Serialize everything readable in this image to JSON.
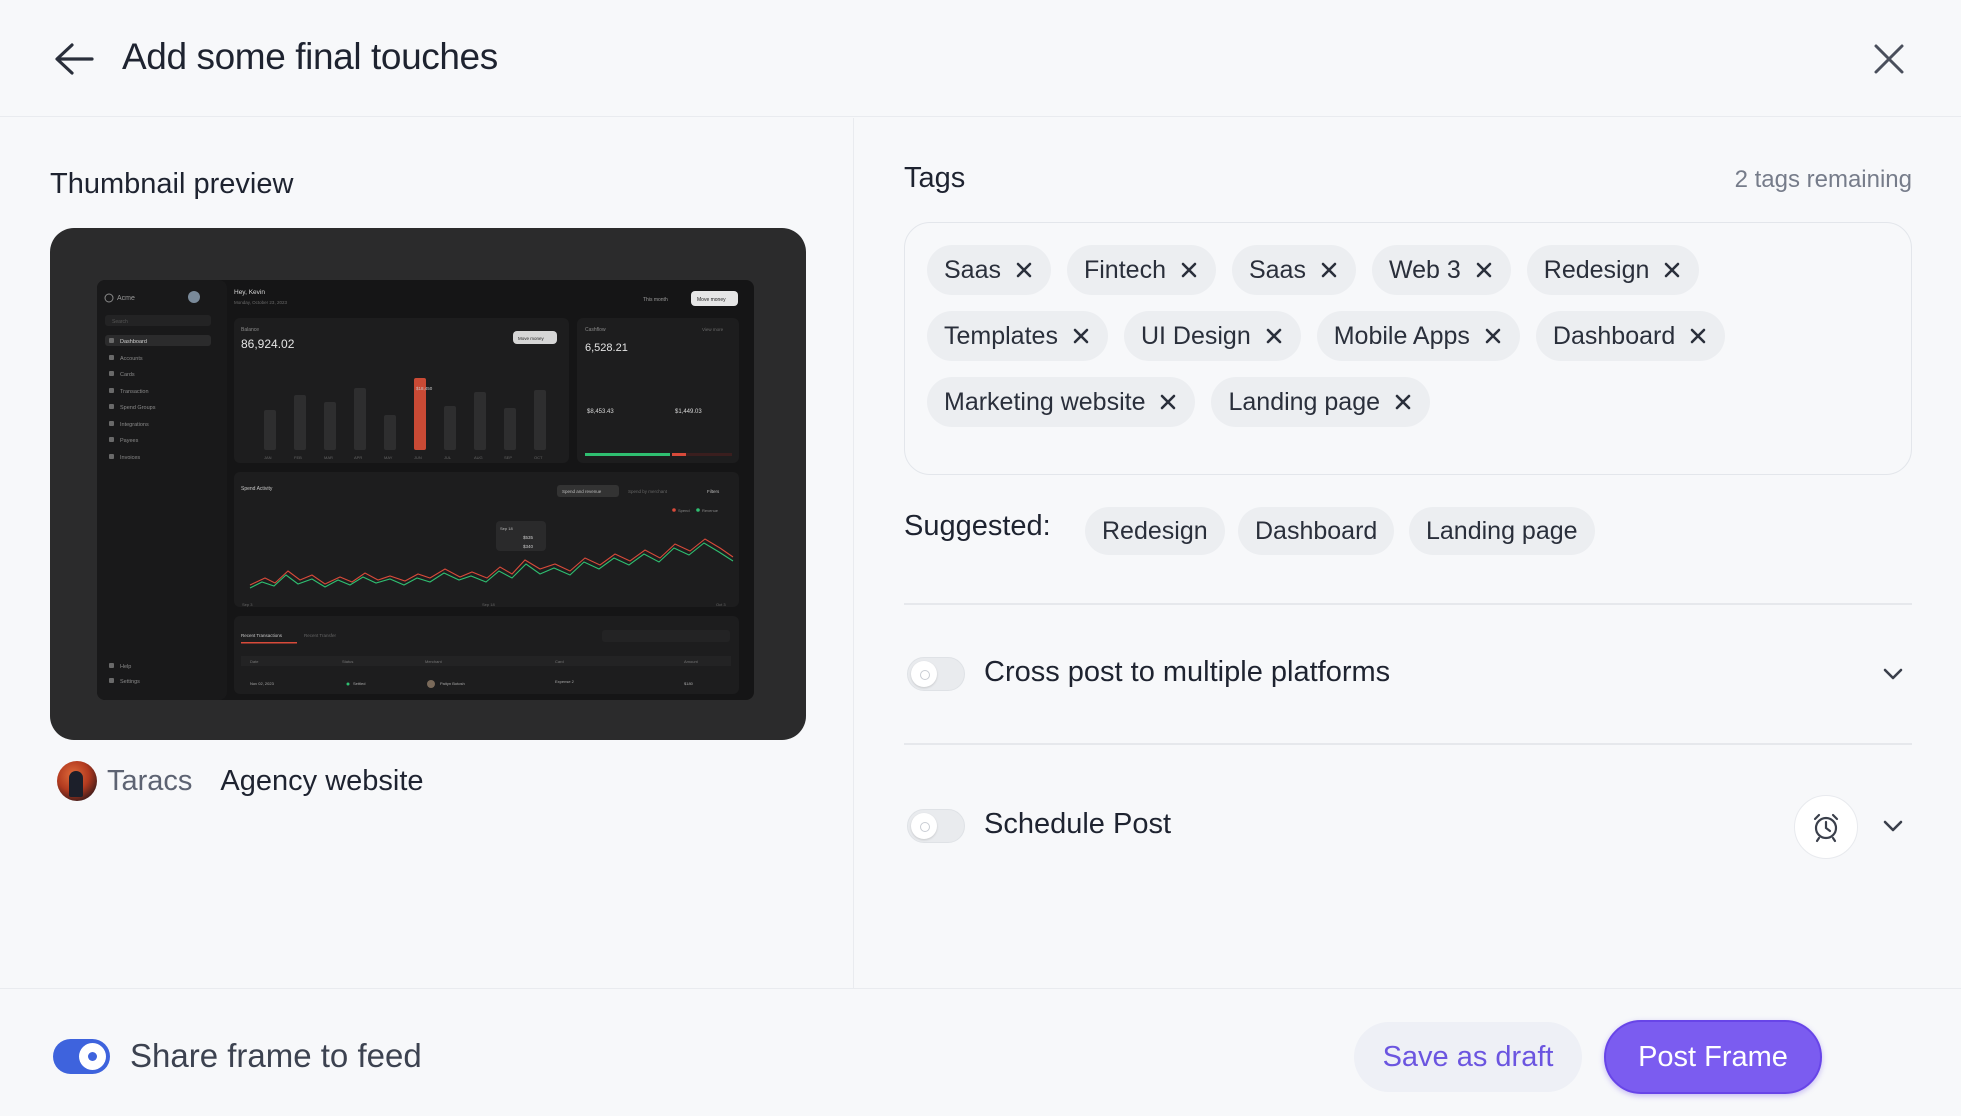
{
  "header": {
    "title": "Add some final touches"
  },
  "thumbnail": {
    "label": "Thumbnail preview",
    "author": "Taracs",
    "project": "Agency website",
    "preview": {
      "brand": "Acme",
      "greeting": "Hey, Kevin",
      "date": "Monday, October 23, 2023",
      "period": "This month",
      "move_money": "Move money",
      "search": "Search",
      "nav": [
        "Dashboard",
        "Accounts",
        "Cards",
        "Transaction",
        "Spend Groups",
        "Integrations",
        "Payees",
        "Invoices"
      ],
      "nav_bottom": [
        "Help",
        "Settings"
      ],
      "balance_label": "Balance",
      "balance_value": "86,924.02",
      "balance_bars": [
        40,
        55,
        48,
        62,
        35,
        72,
        44,
        58,
        42,
        60
      ],
      "balance_highlight": "$18,450",
      "months": [
        "JAN",
        "FEB",
        "MAR",
        "APR",
        "MAY",
        "JUN",
        "JUL",
        "AUG",
        "SEP",
        "OCT"
      ],
      "cashflow_label": "Cashflow",
      "cashflow_value": "6,528.21",
      "view_more": "View more",
      "cash_in": "$8,453.43",
      "cash_out": "$1,449.03",
      "spend_title": "Spend Activity",
      "spend_tab_1": "Spend and revenue",
      "spend_tab_2": "Spend by merchant",
      "filters": "Filters",
      "legend_spend": "Spend",
      "legend_revenue": "Revenue",
      "tooltip_date": "Sep 18",
      "tooltip_spend": "$535",
      "tooltip_revenue": "$340",
      "axis_start": "Sep 3",
      "axis_mid": "Sep 18",
      "axis_end": "Oct 3",
      "tx_tab_1": "Recent Transactions",
      "tx_tab_2": "Recent Transfer",
      "tx_headers": [
        "Date",
        "Status",
        "Merchant",
        "Card",
        "Amount"
      ],
      "tx_row": [
        "Nov 02, 2023",
        "Settled",
        "Paityn Botosh",
        "Expense 2",
        "$180"
      ]
    }
  },
  "tags": {
    "title": "Tags",
    "remaining": "2 tags remaining",
    "rows": [
      [
        "Saas",
        "Fintech",
        "Saas",
        "Web 3",
        "Redesign"
      ],
      [
        "Templates",
        "UI Design",
        "Mobile Apps",
        "Dashboard"
      ],
      [
        "Marketing website",
        "Landing page"
      ]
    ]
  },
  "suggested": {
    "label": "Suggested:",
    "items": [
      "Redesign",
      "Dashboard",
      "Landing page"
    ]
  },
  "options": {
    "cross_post": "Cross post to multiple platforms",
    "schedule": "Schedule Post"
  },
  "footer": {
    "share_label": "Share frame to feed",
    "share_enabled": true,
    "draft": "Save as draft",
    "post": "Post Frame"
  },
  "colors": {
    "accent": "#7b5cf0",
    "toggle_on": "#3e63dd",
    "tag_bg": "#eceef1"
  }
}
